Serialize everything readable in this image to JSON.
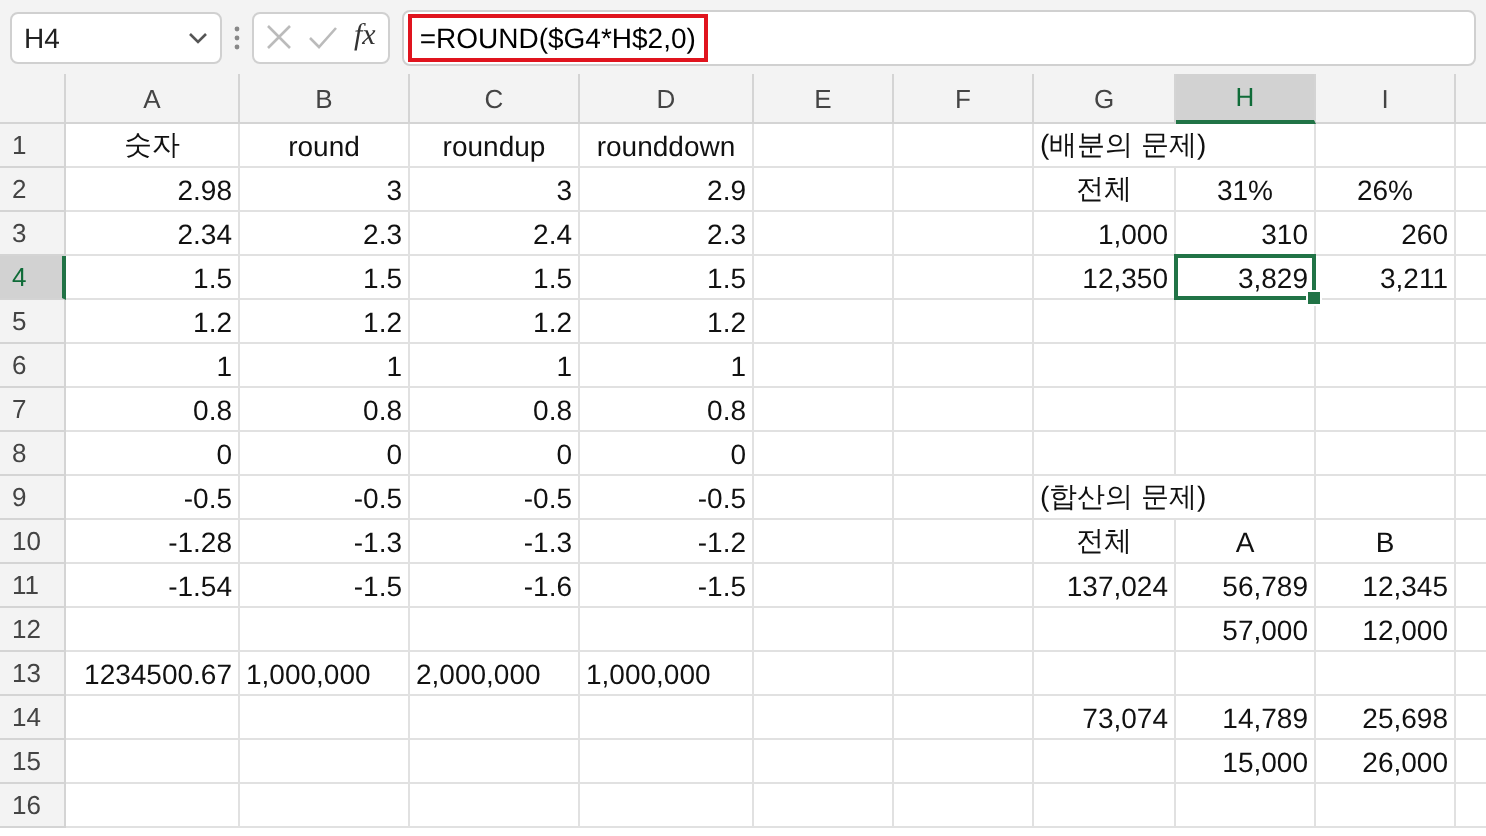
{
  "formula_bar": {
    "name_box": "H4",
    "function_label": "fx",
    "formula": "=ROUND($G4*H$2,0)",
    "formula_highlighted": true
  },
  "columns": [
    {
      "label": "A",
      "selected": false
    },
    {
      "label": "B",
      "selected": false
    },
    {
      "label": "C",
      "selected": false
    },
    {
      "label": "D",
      "selected": false
    },
    {
      "label": "E",
      "selected": false
    },
    {
      "label": "F",
      "selected": false
    },
    {
      "label": "G",
      "selected": false
    },
    {
      "label": "H",
      "selected": true
    },
    {
      "label": "I",
      "selected": false
    }
  ],
  "rows": [
    {
      "number": "1",
      "selected": false,
      "cells": [
        {
          "text": "숫자",
          "kind": "heading"
        },
        {
          "text": "round",
          "kind": "heading"
        },
        {
          "text": "roundup",
          "kind": "heading"
        },
        {
          "text": "rounddown",
          "kind": "heading"
        },
        {},
        {},
        {
          "text": "(배분의 문제)",
          "kind": "title"
        },
        {}
      ]
    },
    {
      "number": "2",
      "selected": false,
      "cells": [
        {
          "text": "2.98",
          "kind": "number"
        },
        {
          "text": "3",
          "kind": "number"
        },
        {
          "text": "3",
          "kind": "number"
        },
        {
          "text": "2.9",
          "kind": "number"
        },
        {},
        {},
        {
          "text": "전체",
          "kind": "heading"
        },
        {
          "text": "31%",
          "kind": "heading"
        },
        {
          "text": "26%",
          "kind": "heading"
        }
      ]
    },
    {
      "number": "3",
      "selected": false,
      "cells": [
        {
          "text": "2.34",
          "kind": "number"
        },
        {
          "text": "2.3",
          "kind": "number"
        },
        {
          "text": "2.4",
          "kind": "number"
        },
        {
          "text": "2.3",
          "kind": "number"
        },
        {},
        {},
        {
          "text": "1,000",
          "kind": "number"
        },
        {
          "text": "310",
          "kind": "number"
        },
        {
          "text": "260",
          "kind": "number"
        }
      ]
    },
    {
      "number": "4",
      "selected": true,
      "cells": [
        {
          "text": "1.5",
          "kind": "number"
        },
        {
          "text": "1.5",
          "kind": "number"
        },
        {
          "text": "1.5",
          "kind": "number"
        },
        {
          "text": "1.5",
          "kind": "number"
        },
        {},
        {},
        {
          "text": "12,350",
          "kind": "number"
        },
        {
          "text": "3,829",
          "kind": "number"
        },
        {
          "text": "3,211",
          "kind": "number"
        }
      ]
    },
    {
      "number": "5",
      "selected": false,
      "cells": [
        {
          "text": "1.2",
          "kind": "number"
        },
        {
          "text": "1.2",
          "kind": "number"
        },
        {
          "text": "1.2",
          "kind": "number"
        },
        {
          "text": "1.2",
          "kind": "number"
        },
        {},
        {},
        {},
        {},
        {}
      ]
    },
    {
      "number": "6",
      "selected": false,
      "cells": [
        {
          "text": "1",
          "kind": "number"
        },
        {
          "text": "1",
          "kind": "number"
        },
        {
          "text": "1",
          "kind": "number"
        },
        {
          "text": "1",
          "kind": "number"
        },
        {},
        {},
        {},
        {},
        {}
      ]
    },
    {
      "number": "7",
      "selected": false,
      "cells": [
        {
          "text": "0.8",
          "kind": "number"
        },
        {
          "text": "0.8",
          "kind": "number"
        },
        {
          "text": "0.8",
          "kind": "number"
        },
        {
          "text": "0.8",
          "kind": "number"
        },
        {},
        {},
        {},
        {},
        {}
      ]
    },
    {
      "number": "8",
      "selected": false,
      "cells": [
        {
          "text": "0",
          "kind": "number"
        },
        {
          "text": "0",
          "kind": "number"
        },
        {
          "text": "0",
          "kind": "number"
        },
        {
          "text": "0",
          "kind": "number"
        },
        {},
        {},
        {},
        {},
        {}
      ]
    },
    {
      "number": "9",
      "selected": false,
      "cells": [
        {
          "text": "-0.5",
          "kind": "number"
        },
        {
          "text": "-0.5",
          "kind": "number"
        },
        {
          "text": "-0.5",
          "kind": "number"
        },
        {
          "text": "-0.5",
          "kind": "number"
        },
        {},
        {},
        {
          "text": "(합산의 문제)",
          "kind": "title"
        },
        {}
      ]
    },
    {
      "number": "10",
      "selected": false,
      "cells": [
        {
          "text": "-1.28",
          "kind": "number"
        },
        {
          "text": "-1.3",
          "kind": "number"
        },
        {
          "text": "-1.3",
          "kind": "number"
        },
        {
          "text": "-1.2",
          "kind": "number"
        },
        {},
        {},
        {
          "text": "전체",
          "kind": "heading"
        },
        {
          "text": "A",
          "kind": "heading"
        },
        {
          "text": "B",
          "kind": "heading"
        }
      ]
    },
    {
      "number": "11",
      "selected": false,
      "cells": [
        {
          "text": "-1.54",
          "kind": "number"
        },
        {
          "text": "-1.5",
          "kind": "number"
        },
        {
          "text": "-1.6",
          "kind": "number"
        },
        {
          "text": "-1.5",
          "kind": "number"
        },
        {},
        {},
        {
          "text": "137,024",
          "kind": "number"
        },
        {
          "text": "56,789",
          "kind": "number"
        },
        {
          "text": "12,345",
          "kind": "number"
        }
      ]
    },
    {
      "number": "12",
      "selected": false,
      "cells": [
        {},
        {},
        {},
        {},
        {},
        {},
        {},
        {
          "text": "57,000",
          "kind": "number"
        },
        {
          "text": "12,000",
          "kind": "number"
        }
      ]
    },
    {
      "number": "13",
      "selected": false,
      "cells": [
        {
          "text": "1234500.67",
          "kind": "number"
        },
        {
          "text": "1,000,000",
          "kind": "text"
        },
        {
          "text": "2,000,000",
          "kind": "text"
        },
        {
          "text": "1,000,000",
          "kind": "text"
        },
        {},
        {},
        {},
        {},
        {}
      ]
    },
    {
      "number": "14",
      "selected": false,
      "cells": [
        {},
        {},
        {},
        {},
        {},
        {},
        {
          "text": "73,074",
          "kind": "number"
        },
        {
          "text": "14,789",
          "kind": "number"
        },
        {
          "text": "25,698",
          "kind": "number"
        }
      ]
    },
    {
      "number": "15",
      "selected": false,
      "cells": [
        {},
        {},
        {},
        {},
        {},
        {},
        {},
        {
          "text": "15,000",
          "kind": "number"
        },
        {
          "text": "26,000",
          "kind": "number"
        }
      ]
    },
    {
      "number": "16",
      "selected": false,
      "cells": [
        {},
        {},
        {},
        {},
        {},
        {},
        {},
        {},
        {}
      ]
    }
  ]
}
